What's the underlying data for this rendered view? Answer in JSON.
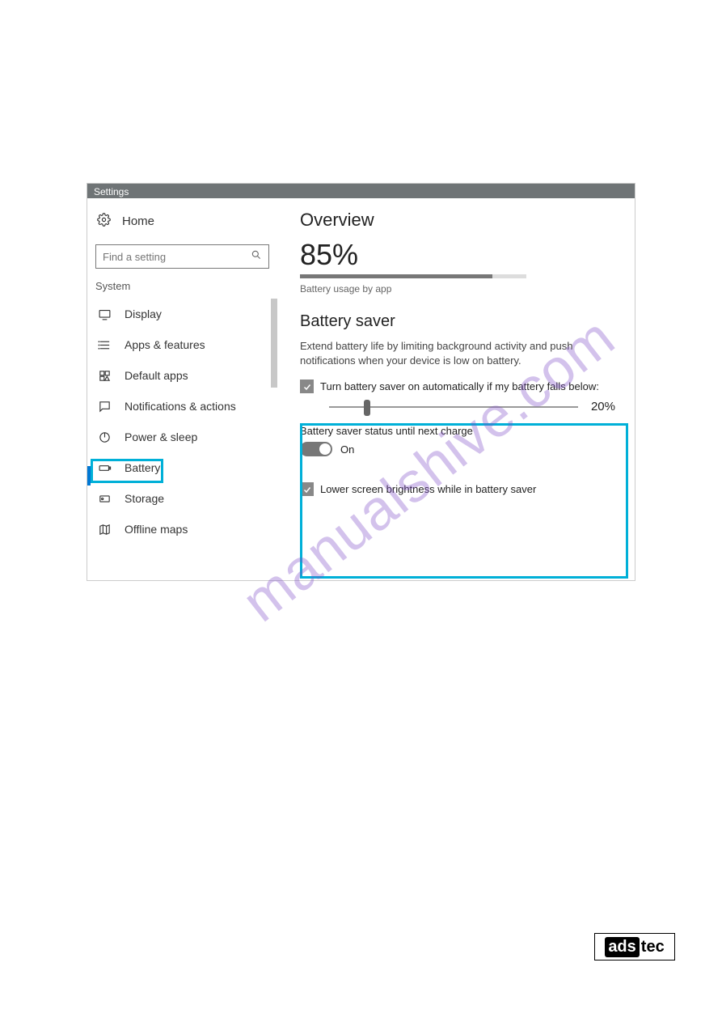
{
  "watermark": "manualshive.com",
  "logo": {
    "ads": "ads",
    "tec": "tec"
  },
  "window": {
    "title": "Settings",
    "home_label": "Home",
    "search_placeholder": "Find a setting",
    "section_label": "System",
    "nav": [
      {
        "key": "display",
        "label": "Display",
        "icon": "monitor"
      },
      {
        "key": "apps",
        "label": "Apps & features",
        "icon": "list"
      },
      {
        "key": "default",
        "label": "Default apps",
        "icon": "defaults"
      },
      {
        "key": "notifications",
        "label": "Notifications & actions",
        "icon": "message"
      },
      {
        "key": "power",
        "label": "Power & sleep",
        "icon": "power"
      },
      {
        "key": "battery",
        "label": "Battery",
        "icon": "battery",
        "active": true
      },
      {
        "key": "storage",
        "label": "Storage",
        "icon": "disk"
      },
      {
        "key": "maps",
        "label": "Offline maps",
        "icon": "map"
      }
    ]
  },
  "main": {
    "overview_title": "Overview",
    "percent": "85%",
    "percent_value": 85,
    "usage_link": "Battery usage by app",
    "saver_title": "Battery saver",
    "saver_desc": "Extend battery life by limiting background activity and push notifications when your device is low on battery.",
    "auto_on_label": "Turn battery saver on automatically if my battery falls below:",
    "threshold_text": "20%",
    "threshold_value": 20,
    "status_label": "Battery saver status until next charge",
    "toggle_state": "On",
    "lower_brightness_label": "Lower screen brightness while in battery saver"
  }
}
